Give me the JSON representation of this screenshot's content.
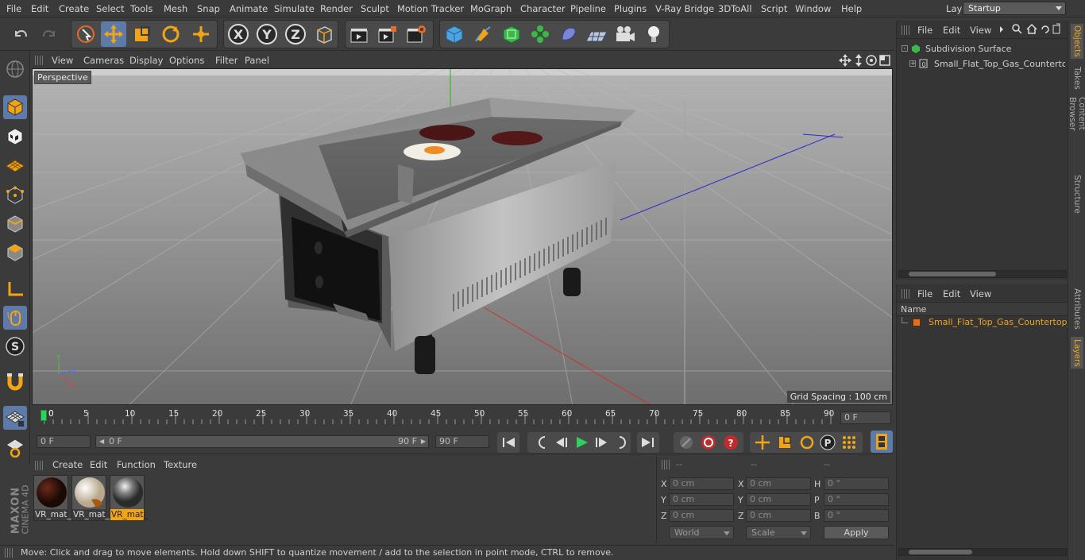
{
  "menubar": {
    "items": [
      "File",
      "Edit",
      "Create",
      "Select",
      "Tools",
      "Mesh",
      "Snap",
      "Animate",
      "Simulate",
      "Render",
      "Sculpt",
      "Motion Tracker",
      "MoGraph",
      "Character",
      "Pipeline",
      "Plugins",
      "V-Ray Bridge",
      "3DToAll",
      "Script",
      "Window",
      "Help"
    ],
    "layout_label": "Layout:",
    "layout_value": "Startup"
  },
  "viewport": {
    "menu": [
      "View",
      "Cameras",
      "Display",
      "Options",
      "Filter",
      "Panel"
    ],
    "label": "Perspective",
    "grid_spacing": "Grid Spacing : 100 cm",
    "axis_x": "X",
    "axis_y": "Y",
    "axis_z": "Z"
  },
  "timeline": {
    "ticks": [
      "0",
      "5",
      "10",
      "15",
      "20",
      "25",
      "30",
      "35",
      "40",
      "45",
      "50",
      "55",
      "60",
      "65",
      "70",
      "75",
      "80",
      "85",
      "90"
    ],
    "current_frame": "0 F"
  },
  "transport": {
    "start_field": "0 F",
    "range_start": "0 F",
    "range_end": "90 F",
    "end_field": "90 F"
  },
  "materials": {
    "menu": [
      "Create",
      "Edit",
      "Function",
      "Texture"
    ],
    "items": [
      {
        "label": "VR_mat_",
        "kind": "dark"
      },
      {
        "label": "VR_mat_",
        "kind": "light"
      },
      {
        "label": "VR_mat_",
        "kind": "metal",
        "selected": true
      }
    ]
  },
  "coords": {
    "headers": [
      "--",
      "--",
      "--"
    ],
    "rows": [
      {
        "l1": "X",
        "v1": "0 cm",
        "l2": "X",
        "v2": "0 cm",
        "l3": "H",
        "v3": "0 °"
      },
      {
        "l1": "Y",
        "v1": "0 cm",
        "l2": "Y",
        "v2": "0 cm",
        "l3": "P",
        "v3": "0 °"
      },
      {
        "l1": "Z",
        "v1": "0 cm",
        "l2": "Z",
        "v2": "0 cm",
        "l3": "B",
        "v3": "0 °"
      }
    ],
    "world": "World",
    "scale": "Scale",
    "apply": "Apply"
  },
  "status": "Move: Click and drag to move elements. Hold down SHIFT to quantize movement / add to the selection in point mode, CTRL to remove.",
  "objects": {
    "menu": [
      "File",
      "Edit",
      "View"
    ],
    "tree": [
      {
        "label": "Subdivision Surface"
      },
      {
        "label": "Small_Flat_Top_Gas_Countertop_"
      }
    ]
  },
  "layers": {
    "menu": [
      "File",
      "Edit",
      "View"
    ],
    "column": "Name",
    "items": [
      {
        "label": "Small_Flat_Top_Gas_Countertop_G"
      }
    ]
  },
  "right_tabs": [
    "Objects",
    "Takes",
    "Content Browser",
    "Structure",
    "Attributes",
    "Layers"
  ],
  "brand": {
    "maker": "MAXON",
    "product": "CINEMA 4D"
  },
  "colors": {
    "accent": "#f2a417",
    "selection": "#5d7aa8"
  }
}
